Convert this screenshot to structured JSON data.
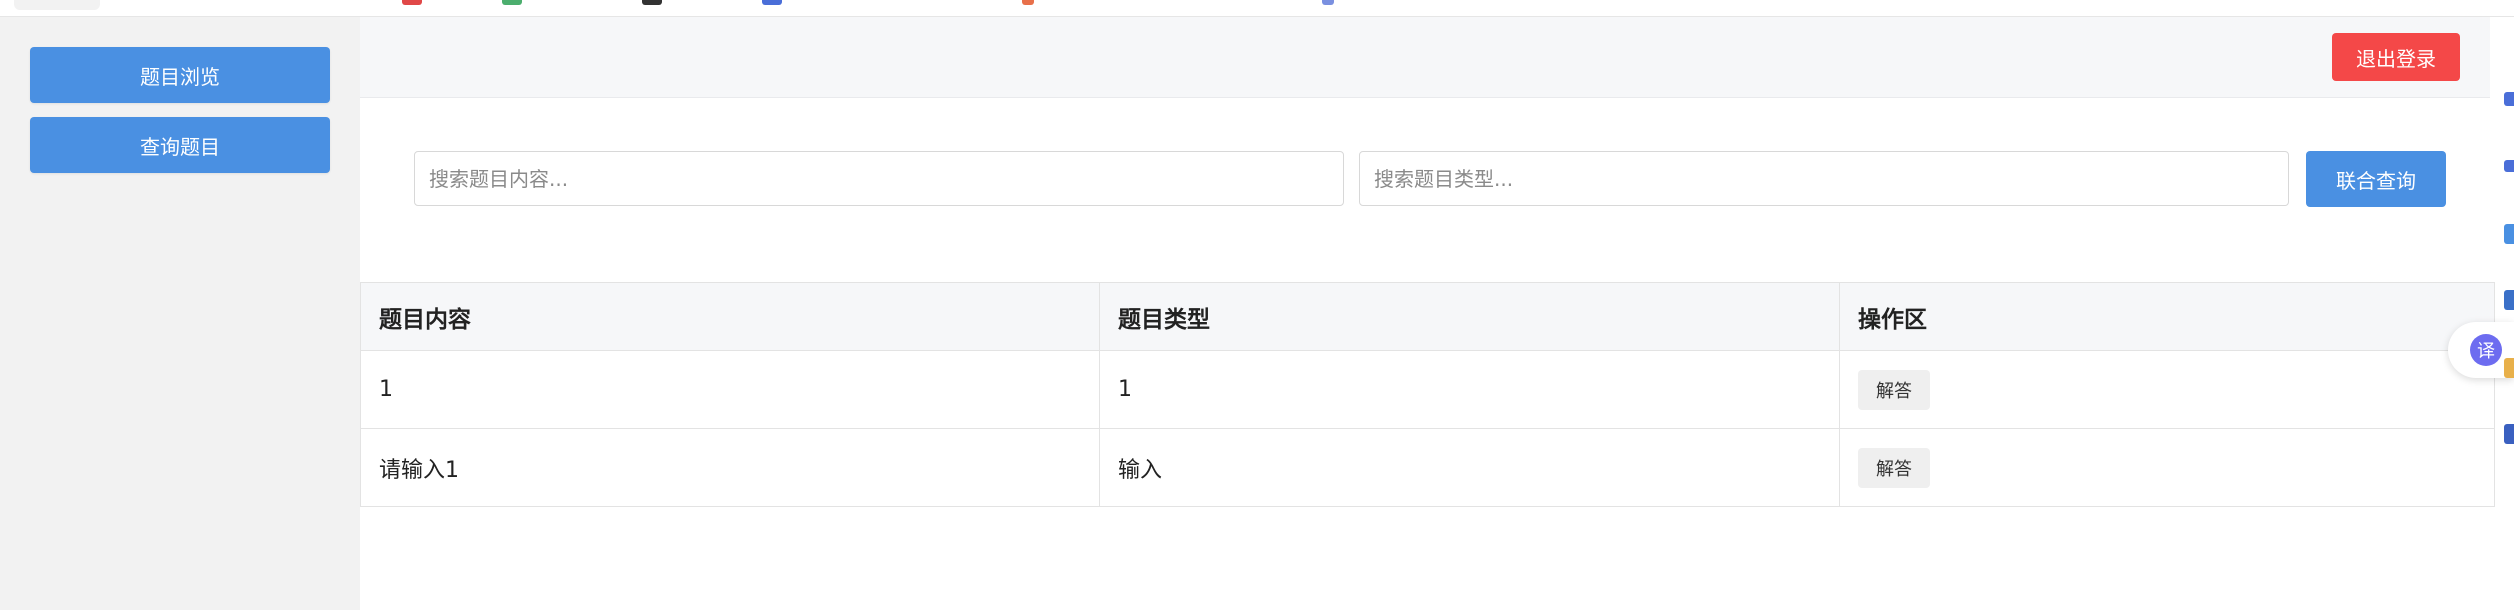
{
  "sidebar": {
    "items": [
      {
        "label": "题目浏览"
      },
      {
        "label": "查询题目"
      }
    ]
  },
  "header": {
    "logout_label": "退出登录"
  },
  "search": {
    "content_placeholder": "搜索题目内容...",
    "type_placeholder": "搜索题目类型...",
    "query_label": "联合查询"
  },
  "table": {
    "columns": [
      "题目内容",
      "题目类型",
      "操作区"
    ],
    "rows": [
      {
        "content": "1",
        "type": "1",
        "action": "解答"
      },
      {
        "content": "请输入1",
        "type": "输入",
        "action": "解答"
      }
    ]
  },
  "widgets": {
    "translate_label": "译",
    "translate_color": "#6d6cf0"
  },
  "colors": {
    "primary": "#4a90e2",
    "danger": "#f44848"
  }
}
